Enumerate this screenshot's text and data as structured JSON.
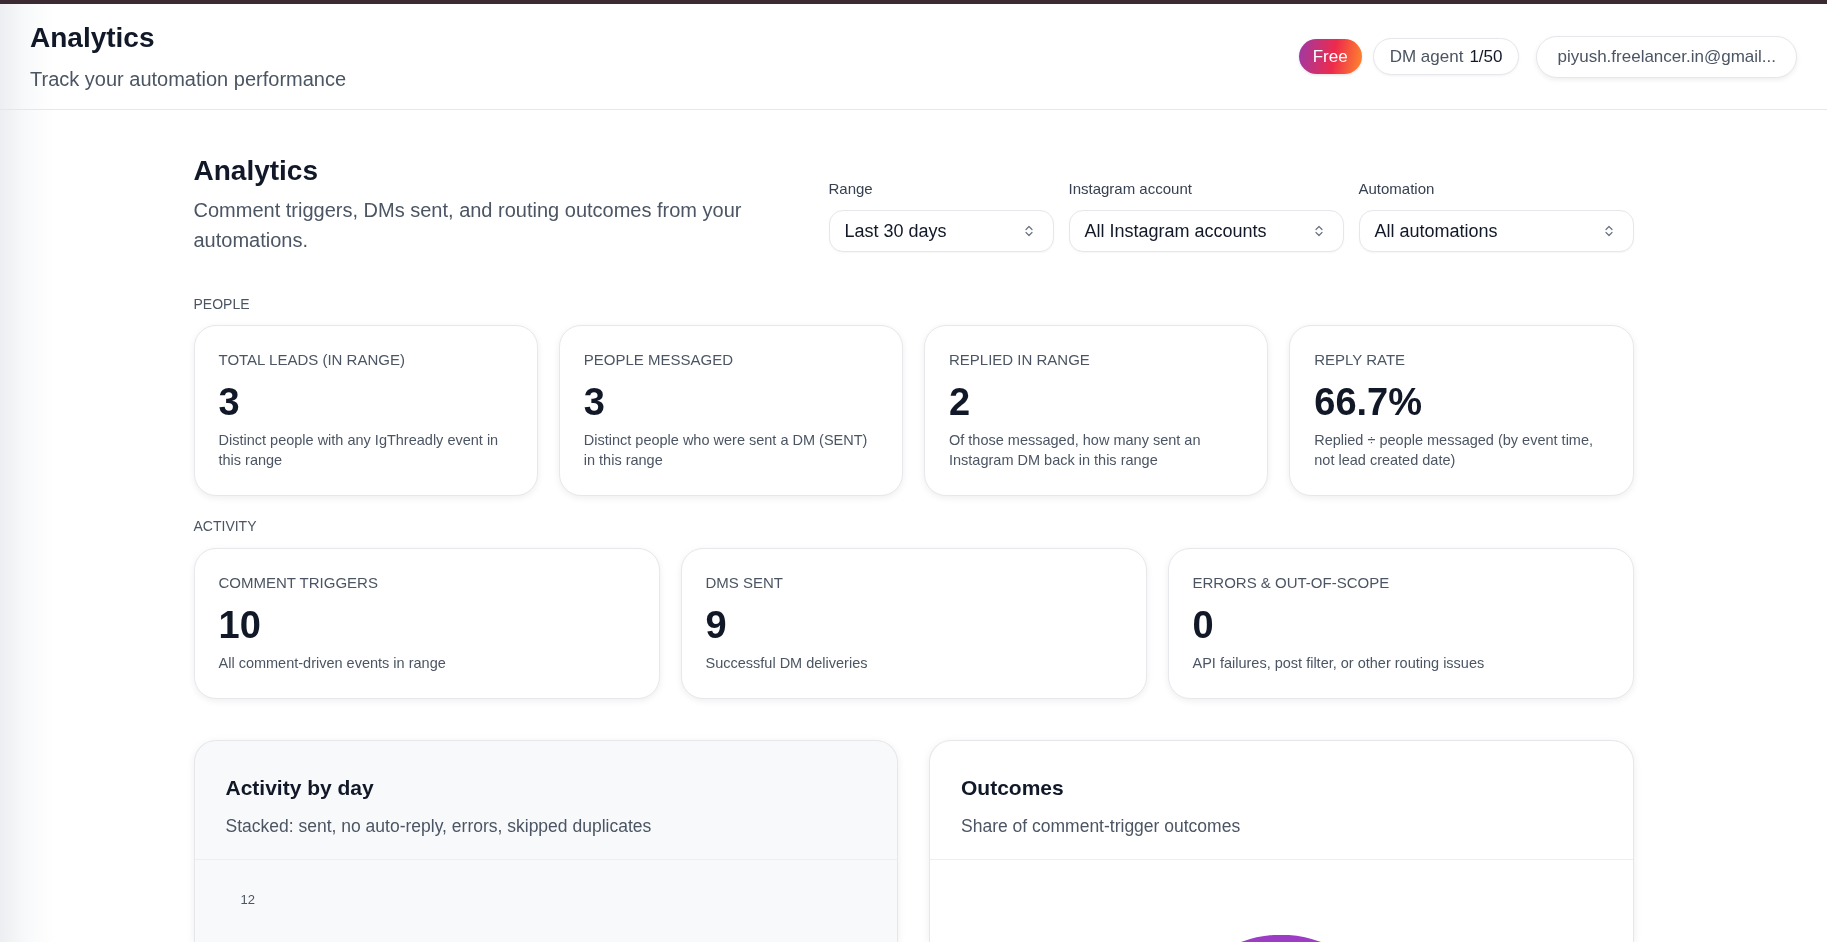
{
  "header": {
    "title": "Analytics",
    "subtitle": "Track your automation performance",
    "plan_badge": "Free",
    "usage": {
      "label": "DM agent",
      "count": "1/50"
    },
    "account": "piyush.freelancer.in@gmail..."
  },
  "intro": {
    "title": "Analytics",
    "description": "Comment triggers, DMs sent, and routing outcomes from your automations."
  },
  "filters": [
    {
      "label": "Range",
      "value": "Last 30 days"
    },
    {
      "label": "Instagram account",
      "value": "All Instagram accounts"
    },
    {
      "label": "Automation",
      "value": "All automations"
    }
  ],
  "sections": [
    {
      "heading": "PEOPLE",
      "cards": [
        {
          "label": "TOTAL LEADS (IN RANGE)",
          "value": "3",
          "description": "Distinct people with any IgThreadly event in this range"
        },
        {
          "label": "PEOPLE MESSAGED",
          "value": "3",
          "description": "Distinct people who were sent a DM (SENT) in this range"
        },
        {
          "label": "REPLIED IN RANGE",
          "value": "2",
          "description": "Of those messaged, how many sent an Instagram DM back in this range"
        },
        {
          "label": "REPLY RATE",
          "value": "66.7%",
          "description": "Replied ÷ people messaged (by event time, not lead created date)"
        }
      ]
    },
    {
      "heading": "ACTIVITY",
      "cards": [
        {
          "label": "COMMENT TRIGGERS",
          "value": "10",
          "description": "All comment-driven events in range"
        },
        {
          "label": "DMS SENT",
          "value": "9",
          "description": "Successful DM deliveries"
        },
        {
          "label": "ERRORS & OUT-OF-SCOPE",
          "value": "0",
          "description": "API failures, post filter, or other routing issues"
        }
      ]
    }
  ],
  "panels": [
    {
      "kind": "bar",
      "title": "Activity by day",
      "subtitle": "Stacked: sent, no auto-reply, errors, skipped duplicates",
      "y_tick": "12"
    },
    {
      "kind": "donut",
      "title": "Outcomes",
      "subtitle": "Share of comment-trigger outcomes"
    }
  ]
}
